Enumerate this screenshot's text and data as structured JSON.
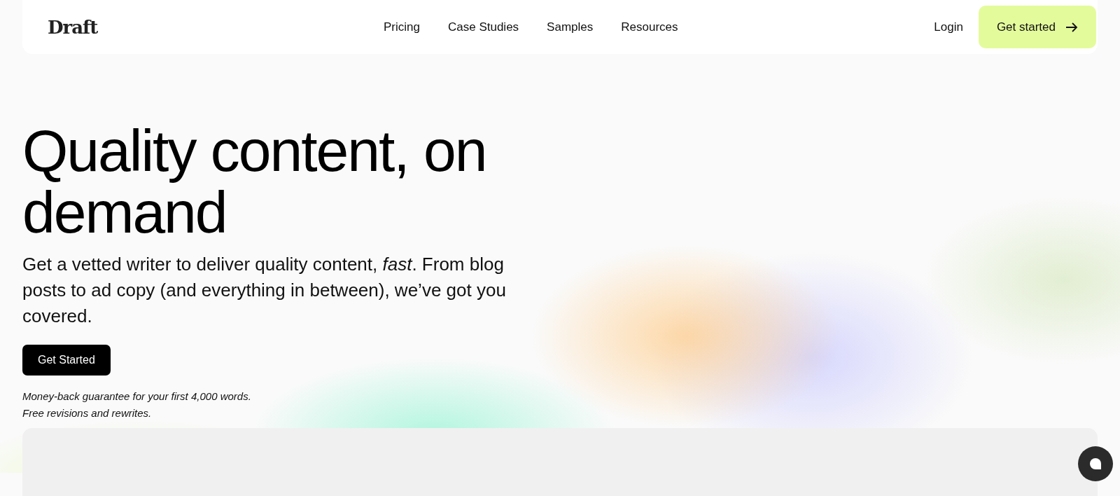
{
  "header": {
    "logo": "Draft",
    "nav": [
      {
        "label": "Pricing"
      },
      {
        "label": "Case Studies"
      },
      {
        "label": "Samples"
      },
      {
        "label": "Resources"
      }
    ],
    "login": "Login",
    "cta": "Get started"
  },
  "hero": {
    "title": "Quality content, on demand",
    "subtitle": "Get a vetted writer to deliver quality content, *fast*. From blog posts to ad copy (and everything in between), we’ve got you covered.",
    "button": "Get Started",
    "notes": [
      "Money-back guarantee for your first 4,000 words.",
      "Free revisions and rewrites."
    ]
  }
}
